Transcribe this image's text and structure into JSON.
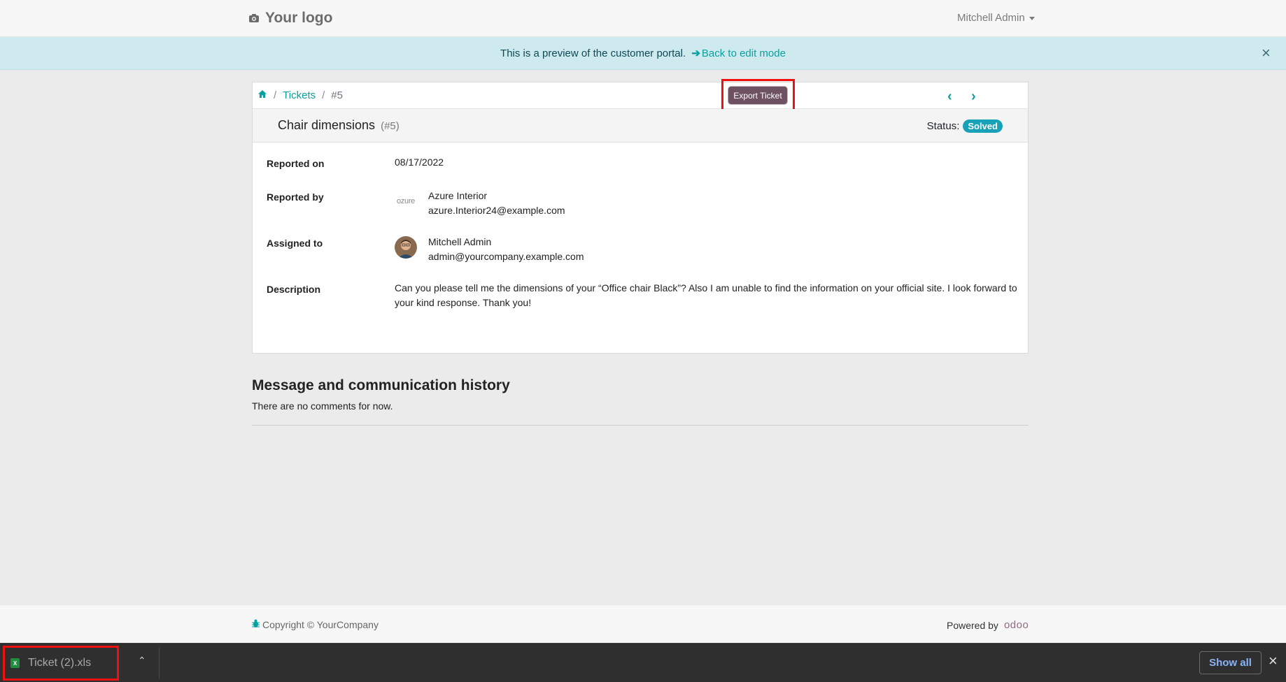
{
  "header": {
    "logo_text": "Your logo",
    "user_name": "Mitchell Admin"
  },
  "preview_alert": {
    "message": "This is a preview of the customer portal.",
    "back_link": "Back to edit mode",
    "close": "×"
  },
  "breadcrumb": {
    "tickets": "Tickets",
    "current": "#5",
    "separator": "/"
  },
  "export_button": "Export Ticket",
  "pager": {
    "prev": "‹",
    "next": "›"
  },
  "ticket": {
    "title": "Chair dimensions",
    "number": "(#5)",
    "status_label": "Status:",
    "status": "Solved"
  },
  "fields": {
    "reported_on_label": "Reported on",
    "reported_on": "08/17/2022",
    "reported_by_label": "Reported by",
    "reported_by_name": "Azure Interior",
    "reported_by_email": "azure.Interior24@example.com",
    "reported_by_logo": "ozure",
    "assigned_to_label": "Assigned to",
    "assigned_to_name": "Mitchell Admin",
    "assigned_to_email": "admin@yourcompany.example.com",
    "description_label": "Description",
    "description": "Can you please tell me the dimensions of your “Office chair Black”? Also I am unable to find the information on your official site. I look forward to your kind response. Thank you!"
  },
  "history": {
    "title": "Message and communication history",
    "empty": "There are no comments for now."
  },
  "footer": {
    "copyright": "Copyright © YourCompany",
    "powered_by": "Powered by",
    "odoo": "odoo"
  },
  "download_bar": {
    "file_name": "Ticket (2).xls",
    "file_icon_text": "X",
    "chevron": "⌃",
    "show_all": "Show all",
    "close": "×"
  },
  "colors": {
    "accent": "#0aa0a0",
    "export_button": "#6e5162",
    "status_badge": "#17a2b8",
    "highlight": "#ee1111"
  },
  "icons": [
    "camera-icon",
    "home-icon",
    "arrow-right-icon",
    "bug-icon",
    "xls-file-icon"
  ]
}
